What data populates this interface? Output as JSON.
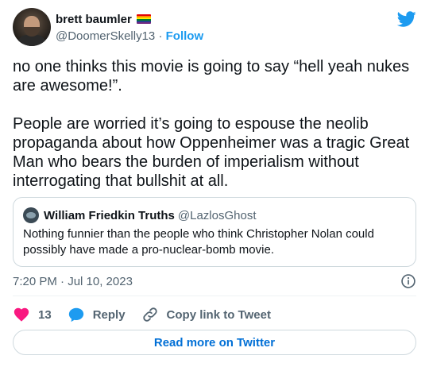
{
  "author": {
    "display_name": "brett baumler",
    "handle": "@DoomerSkelly13",
    "separator": "·",
    "follow_label": "Follow",
    "flag_colors": [
      "#e40303",
      "#ff8c00",
      "#ffed00",
      "#008026",
      "#24408e",
      "#732982"
    ],
    "logo_icon": "twitter-bird-icon",
    "logo_color": "#1d9bf0"
  },
  "tweet": {
    "paragraphs": [
      "no one thinks this movie is going to say “hell yeah nukes are awesome!”.",
      "People are worried it’s going to espouse the neolib propaganda about how Oppenheimer was a tragic Great Man who bears the burden of imperialism without interrogating that bullshit at all."
    ]
  },
  "quoted_tweet": {
    "display_name": "William Friedkin Truths",
    "handle": "@LazlosGhost",
    "text": "Nothing funnier than the people who think Christopher Nolan could possibly have made a pro-nuclear-bomb movie."
  },
  "meta": {
    "timestamp": "7:20 PM · Jul 10, 2023",
    "info_icon": "info-icon"
  },
  "actions": {
    "like_count": "13",
    "like_color": "#f91880",
    "reply_label": "Reply",
    "reply_color": "#1d9bf0",
    "copy_label": "Copy link to Tweet"
  },
  "footer": {
    "read_more_label": "Read more on Twitter"
  }
}
